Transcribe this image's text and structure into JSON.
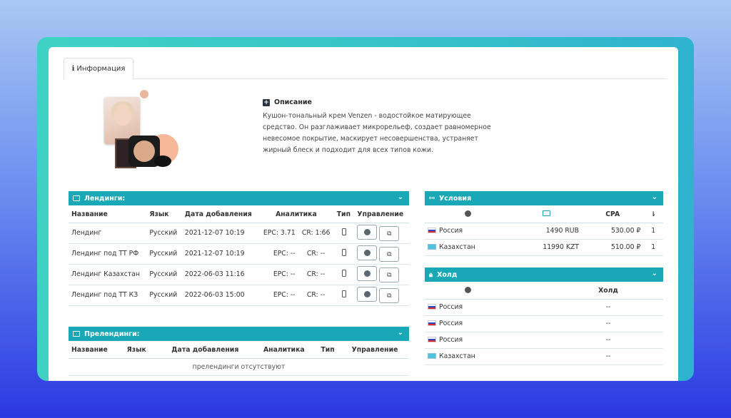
{
  "tabs": [
    {
      "label": "Информация"
    }
  ],
  "description": {
    "title": "Описание",
    "text": "Кушон-тональный крем Venzen - водостойкое матирующее средство. Он разглаживает микрорельеф, создает равномерное невесомое покрытие, маскирует несовершенства, устраняет жирный блеск и подходит для всех типов кожи."
  },
  "landings": {
    "title": "Лендинги:",
    "columns": [
      "Название",
      "Язык",
      "Дата добавления",
      "Аналитика",
      "Тип",
      "Управление"
    ],
    "rows": [
      {
        "name": "Лендинг",
        "lang": "Русский",
        "date": "2021-12-07 10:19",
        "epc": "EPC: 3.71",
        "cr": "CR: 1:66"
      },
      {
        "name": "Лендинг под ТТ РФ",
        "lang": "Русский",
        "date": "2021-12-07 10:19",
        "epc": "EPC: --",
        "cr": "CR: --"
      },
      {
        "name": "Лендинг Казахстан",
        "lang": "Русский",
        "date": "2022-06-03 11:16",
        "epc": "EPC: --",
        "cr": "CR: --"
      },
      {
        "name": "Лендинг под ТТ КЗ",
        "lang": "Русский",
        "date": "2022-06-03 15:00",
        "epc": "EPC: --",
        "cr": "CR: --"
      }
    ]
  },
  "prelandings": {
    "title": "Прелендинги:",
    "columns": [
      "Название",
      "Язык",
      "Дата добавления",
      "Аналитика",
      "Тип",
      "Управление"
    ],
    "empty": "прелендинги отсутствуют"
  },
  "conditions": {
    "title": "Условия",
    "columns": {
      "cpa": "CPA",
      "last": "⇂"
    },
    "rows": [
      {
        "country": "Россия",
        "price": "1490 RUB",
        "cpa": "530.00 ₽",
        "count": "1"
      },
      {
        "country": "Казахстан",
        "price": "11990 KZT",
        "cpa": "510.00 ₽",
        "count": "1"
      }
    ]
  },
  "hold": {
    "title": "Холд",
    "column": "Холд",
    "rows": [
      {
        "country": "Россия",
        "value": "--"
      },
      {
        "country": "Россия",
        "value": "--"
      },
      {
        "country": "Россия",
        "value": "--"
      },
      {
        "country": "Казахстан",
        "value": "--"
      }
    ]
  },
  "colors": {
    "accent": "#1aa8b6",
    "frame": "#38c4c8"
  }
}
